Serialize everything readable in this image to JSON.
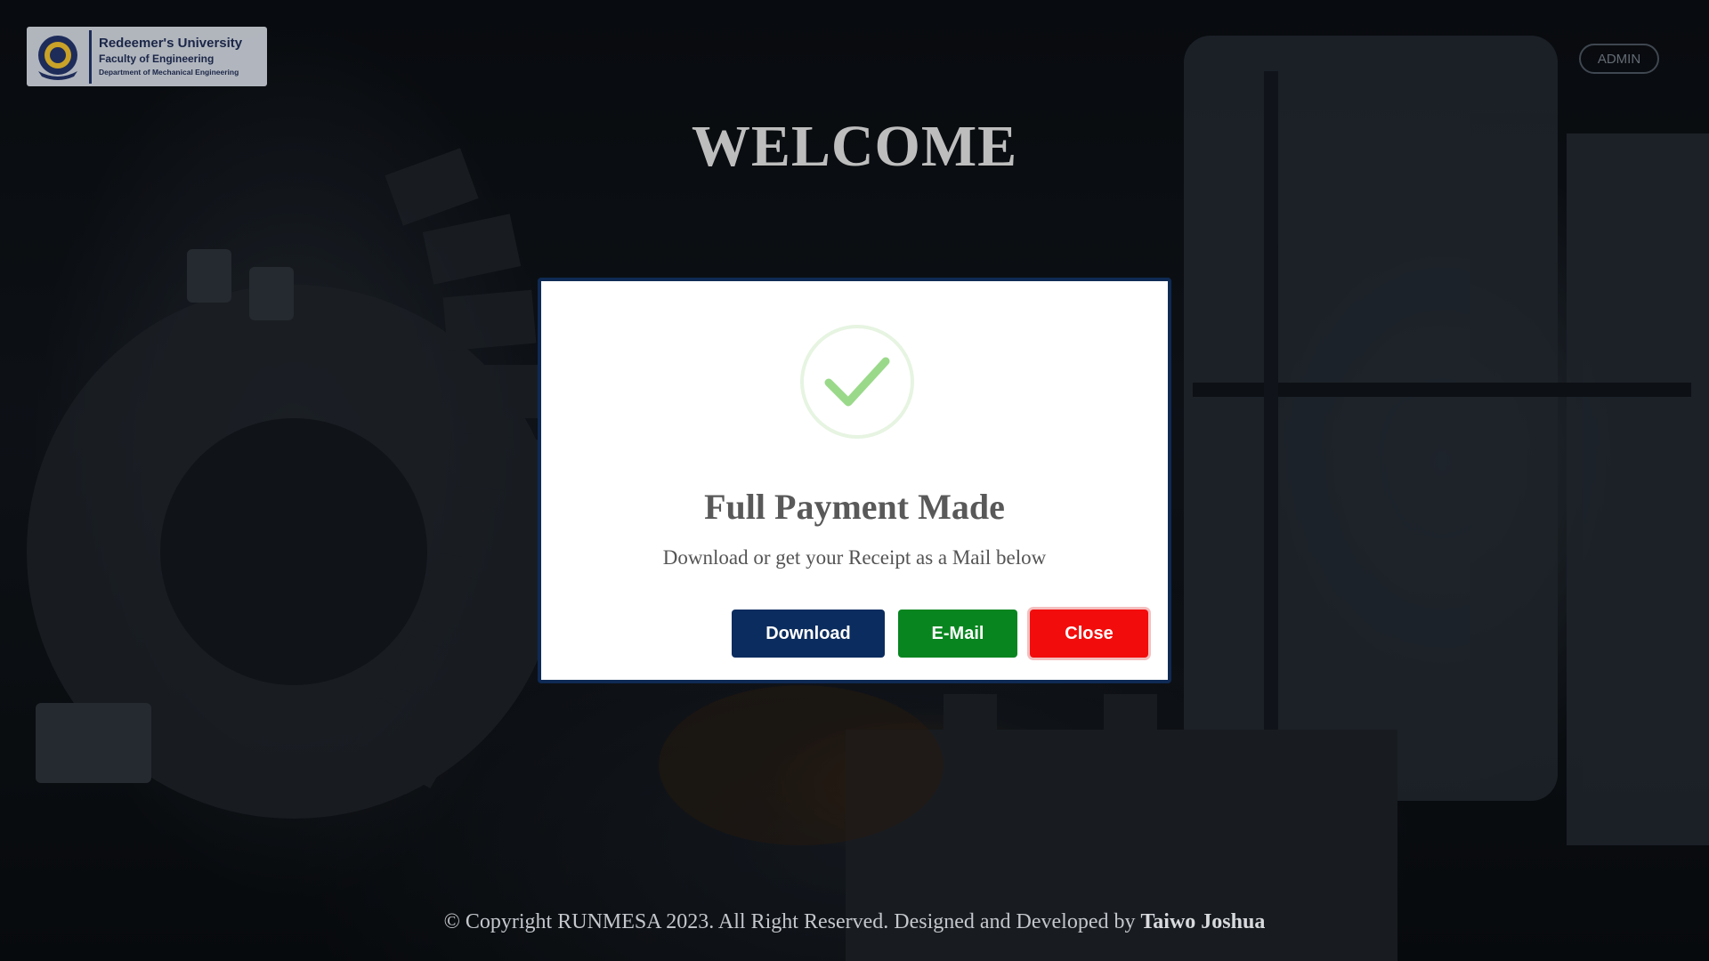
{
  "header": {
    "logo": {
      "university": "Redeemer's University",
      "faculty": "Faculty of Engineering",
      "department": "Department of Mechanical Engineering"
    },
    "admin_label": "ADMIN"
  },
  "main": {
    "welcome": "WELCOME"
  },
  "modal": {
    "icon": "check-circle-icon",
    "title": "Full Payment Made",
    "message": "Download or get your Receipt as a Mail below",
    "buttons": {
      "download": "Download",
      "email": "E-Mail",
      "close": "Close"
    }
  },
  "footer": {
    "text": "© Copyright RUNMESA 2023. All Right Reserved. Designed and Developed by",
    "author": "Taiwo Joshua"
  },
  "colors": {
    "primary_navy": "#0b2c5e",
    "success_green": "#08851f",
    "danger_red": "#f30c0c",
    "check_green": "#9ad98a"
  }
}
